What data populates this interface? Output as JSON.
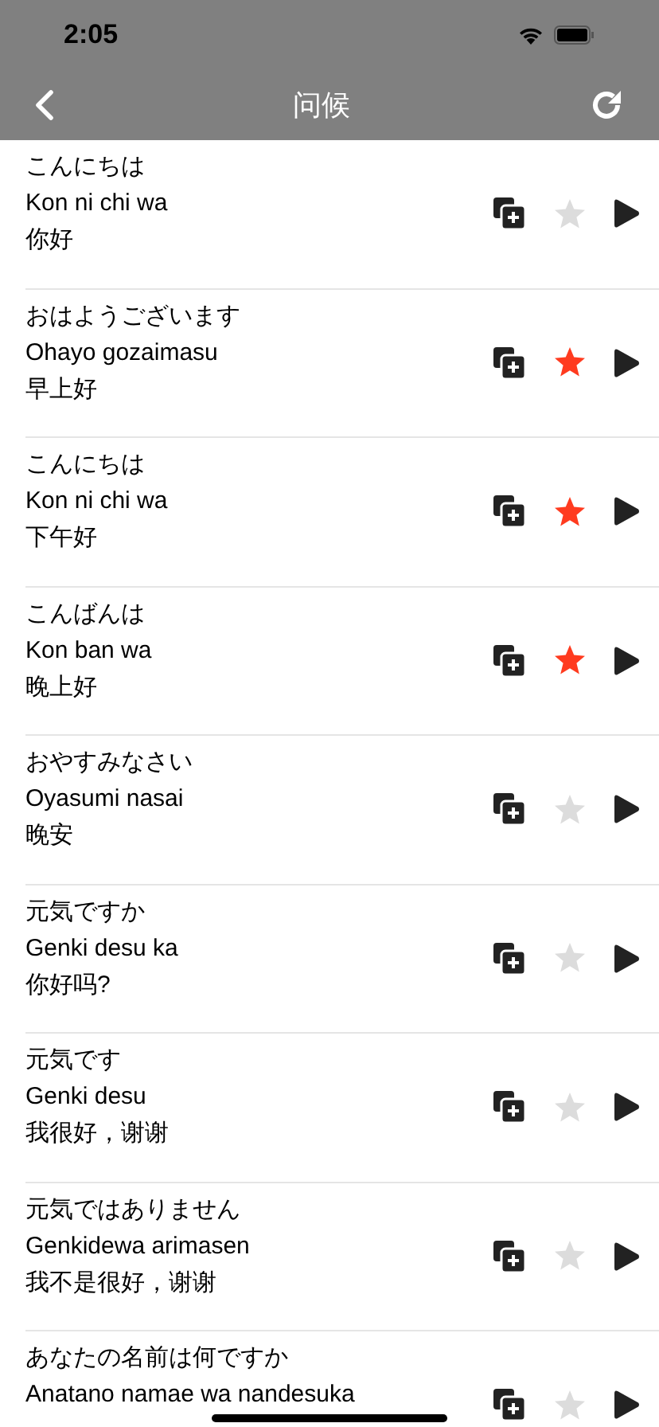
{
  "status_bar": {
    "time": "2:05"
  },
  "nav": {
    "title": "问候"
  },
  "phrases": [
    {
      "japanese": "こんにちは",
      "romaji": "Kon ni chi wa",
      "chinese": "你好",
      "starred": false
    },
    {
      "japanese": "おはようございます",
      "romaji": "Ohayo gozaimasu",
      "chinese": "早上好",
      "starred": true
    },
    {
      "japanese": "こんにちは",
      "romaji": "Kon ni chi wa",
      "chinese": "下午好",
      "starred": true
    },
    {
      "japanese": "こんばんは",
      "romaji": "Kon ban wa",
      "chinese": "晚上好",
      "starred": true
    },
    {
      "japanese": "おやすみなさい",
      "romaji": "Oyasumi nasai",
      "chinese": "晚安",
      "starred": false
    },
    {
      "japanese": "元気ですか",
      "romaji": "Genki desu ka",
      "chinese": "你好吗?",
      "starred": false
    },
    {
      "japanese": "元気です",
      "romaji": "Genki desu",
      "chinese": "我很好，谢谢",
      "starred": false
    },
    {
      "japanese": "元気ではありません",
      "romaji": "Genkidewa arimasen",
      "chinese": "我不是很好，谢谢",
      "starred": false
    },
    {
      "japanese": "あなたの名前は何ですか",
      "romaji": "Anatano namae wa nandesuka",
      "starred": false
    }
  ]
}
